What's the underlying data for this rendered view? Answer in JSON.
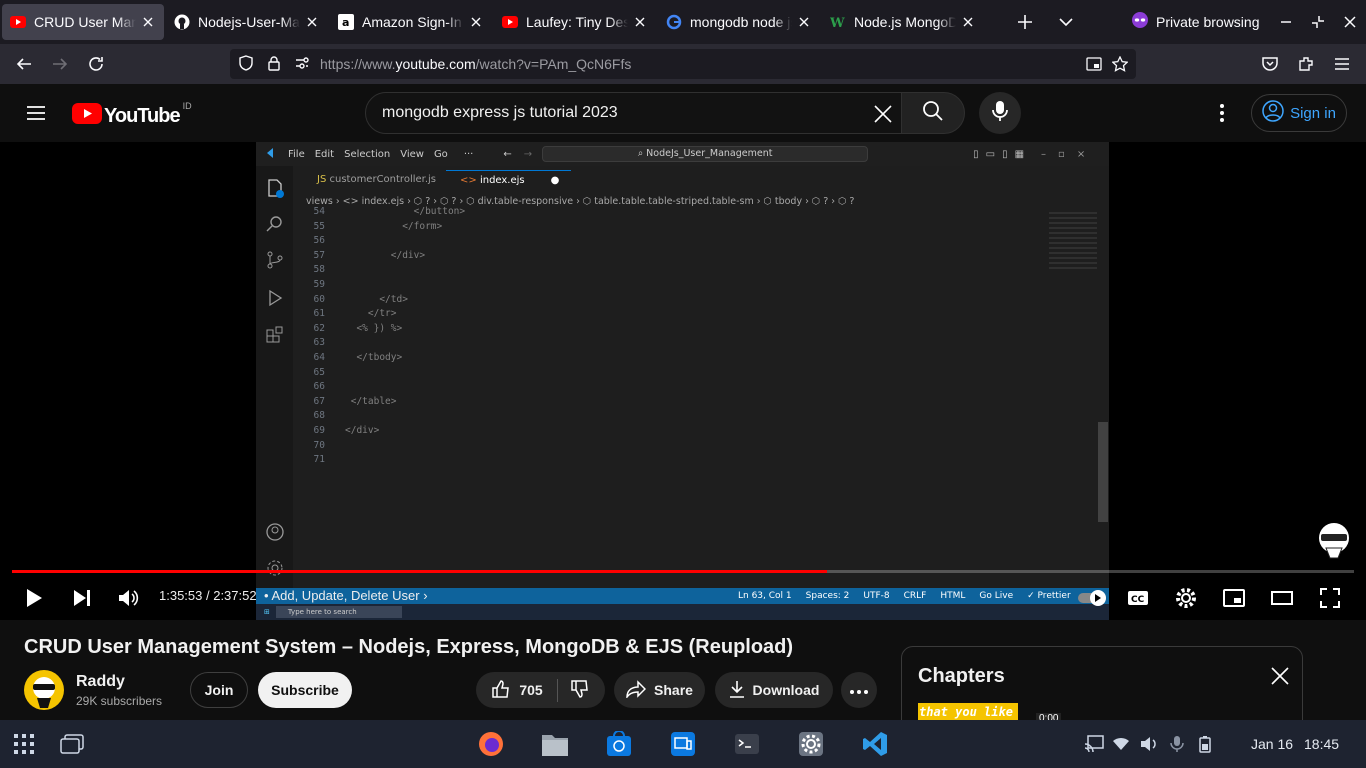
{
  "browser": {
    "tabs": [
      {
        "label": "CRUD User Mana",
        "favicon": "youtube-icon"
      },
      {
        "label": "Nodejs-User-Mar",
        "favicon": "github-icon"
      },
      {
        "label": "Amazon Sign-In",
        "favicon": "amazon-icon"
      },
      {
        "label": "Laufey: Tiny Desk",
        "favicon": "youtube-icon"
      },
      {
        "label": "mongodb node js",
        "favicon": "google-icon"
      },
      {
        "label": "Node.js MongoDE",
        "favicon": "w-icon"
      }
    ],
    "private_label": "Private browsing",
    "url_prefix": "https://www.",
    "url_host": "youtube.com",
    "url_path": "/watch?v=PAm_QcN6Ffs"
  },
  "youtube": {
    "logo_text": "YouTube",
    "region": "ID",
    "search_value": "mongodb express js tutorial 2023",
    "sign_in": "Sign in"
  },
  "video": {
    "vscode": {
      "menu": [
        "File",
        "Edit",
        "Selection",
        "View",
        "Go",
        "···"
      ],
      "search": "NodeJs_User_Management",
      "tabs": [
        "customerController.js",
        "index.ejs"
      ],
      "breadcrumb": "views  ›  <> index.ejs  ›  ⬡ ?  ›  ⬡ ?  ›  ⬡ div.table-responsive  ›  ⬡ table.table.table-striped.table-sm  ›  ⬡ tbody  ›  ⬡ ?  ›  ⬡ ?",
      "lines": [
        {
          "n": "54",
          "code": "            </button>"
        },
        {
          "n": "55",
          "code": "          </form>"
        },
        {
          "n": "56",
          "code": ""
        },
        {
          "n": "57",
          "code": "        </div>"
        },
        {
          "n": "58",
          "code": ""
        },
        {
          "n": "59",
          "code": ""
        },
        {
          "n": "60",
          "code": "      </td>"
        },
        {
          "n": "61",
          "code": "    </tr>"
        },
        {
          "n": "62",
          "code": "  <% }) %>"
        },
        {
          "n": "63",
          "code": ""
        },
        {
          "n": "64",
          "code": "  </tbody>"
        },
        {
          "n": "65",
          "code": ""
        },
        {
          "n": "66",
          "code": ""
        },
        {
          "n": "67",
          "code": " </table>"
        },
        {
          "n": "68",
          "code": ""
        },
        {
          "n": "69",
          "code": "</div>"
        },
        {
          "n": "70",
          "code": ""
        },
        {
          "n": "71",
          "code": ""
        }
      ],
      "status": [
        "Ln 63, Col 1",
        "Spaces: 2",
        "UTF-8",
        "CRLF",
        "HTML",
        "Go Live",
        "✓ Prettier"
      ],
      "taskbar_search": "Type here to search"
    },
    "progress_percent": 60.7,
    "time": "1:35:53 / 2:37:52",
    "chapter": "• Add, Update, Delete User"
  },
  "meta": {
    "title": "CRUD User Management System – Nodejs, Express, MongoDB & EJS (Reupload)",
    "channel": "Raddy",
    "subscribers": "29K subscribers",
    "join": "Join",
    "subscribe": "Subscribe",
    "likes": "705",
    "share": "Share",
    "download": "Download"
  },
  "chapters": {
    "title": "Chapters",
    "thumb_text": "that you like",
    "thumb_time": "0:00"
  },
  "taskbar": {
    "date": "Jan 16",
    "time": "18:45"
  }
}
